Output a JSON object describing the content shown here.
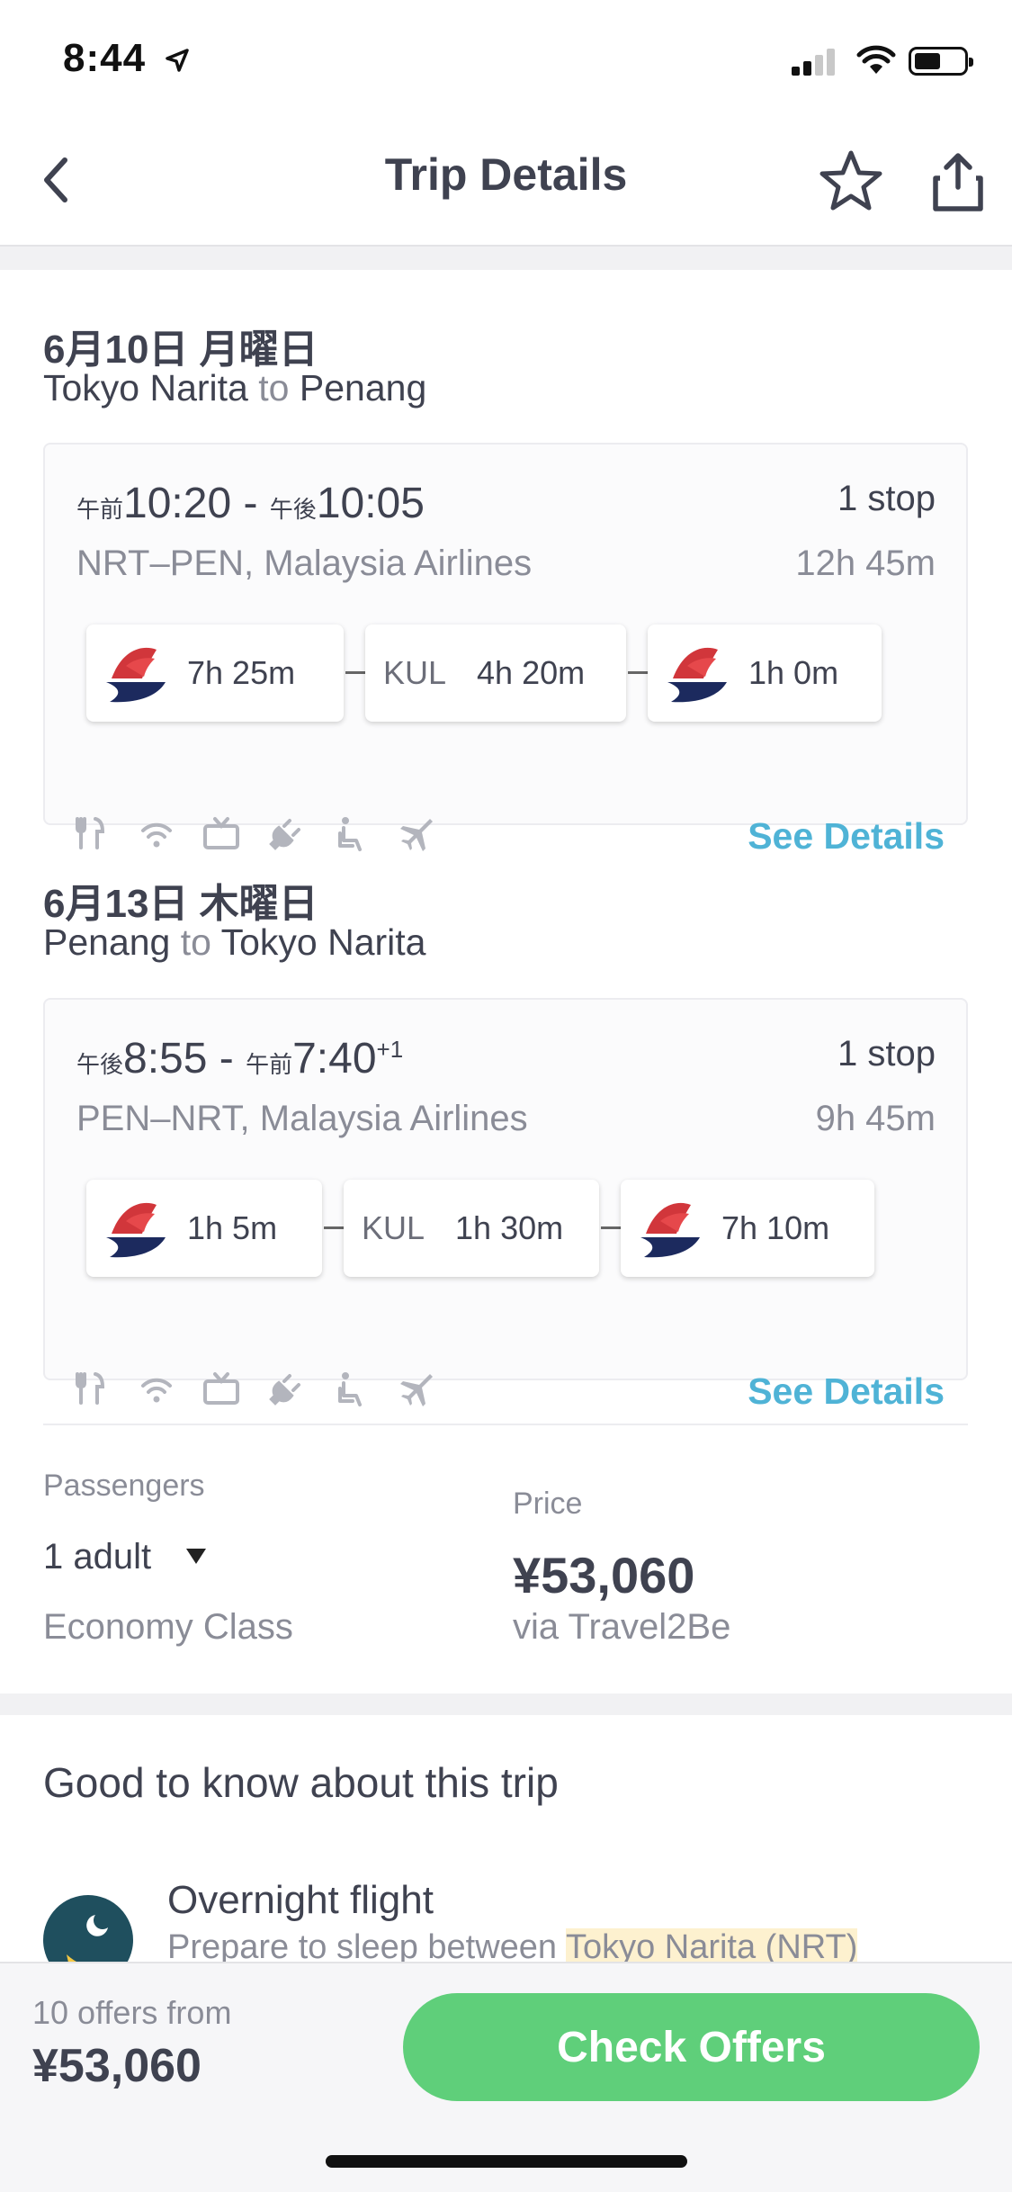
{
  "status": {
    "time": "8:44"
  },
  "nav": {
    "title": "Trip Details"
  },
  "outbound": {
    "date": "6月10日 月曜日",
    "origin": "Tokyo Narita",
    "to": "to",
    "destination": "Penang",
    "depart_ampm": "午前",
    "depart_time": "10:20",
    "separator": " - ",
    "arrive_ampm": "午後",
    "arrive_time": "10:05",
    "stops": "1 stop",
    "airline": "NRT–PEN, Malaysia Airlines",
    "duration": "12h 45m",
    "segments": [
      {
        "duration": "7h 25m"
      },
      {
        "airport": "KUL",
        "layover": "4h 20m"
      },
      {
        "duration": "1h 0m"
      }
    ],
    "see_details": "See Details"
  },
  "return": {
    "date": "6月13日 木曜日",
    "origin": "Penang",
    "to": "to",
    "destination": "Tokyo Narita",
    "depart_ampm": "午後",
    "depart_time": "8:55",
    "separator": " - ",
    "arrive_ampm": "午前",
    "arrive_time": "7:40",
    "day_offset": "+1",
    "stops": "1 stop",
    "airline": "PEN–NRT, Malaysia Airlines",
    "duration": "9h 45m",
    "segments": [
      {
        "duration": "1h 5m"
      },
      {
        "airport": "KUL",
        "layover": "1h 30m"
      },
      {
        "duration": "7h 10m"
      }
    ],
    "see_details": "See Details"
  },
  "amenity_icons": [
    "meal-icon",
    "wifi-icon",
    "tv-icon",
    "power-icon",
    "seat-icon",
    "plane-icon"
  ],
  "booking": {
    "passengers_label": "Passengers",
    "passengers_value": "1 adult",
    "cabin_class": "Economy Class",
    "price_label": "Price",
    "price": "¥53,060",
    "via": "via Travel2Be"
  },
  "good_to_know": {
    "title": "Good to know about this trip",
    "item_title": "Overnight flight",
    "item_desc_prefix": "Prepare to sleep between ",
    "item_desc_highlight": "Tokyo Narita (NRT)"
  },
  "bottom": {
    "offers_from": "10 offers from",
    "price": "¥53,060",
    "cta": "Check Offers"
  },
  "colors": {
    "accent_link": "#4fb3d6",
    "cta_green": "#5fcf7a",
    "airline_red": "#d1363b",
    "airline_navy": "#1c2a5e"
  }
}
